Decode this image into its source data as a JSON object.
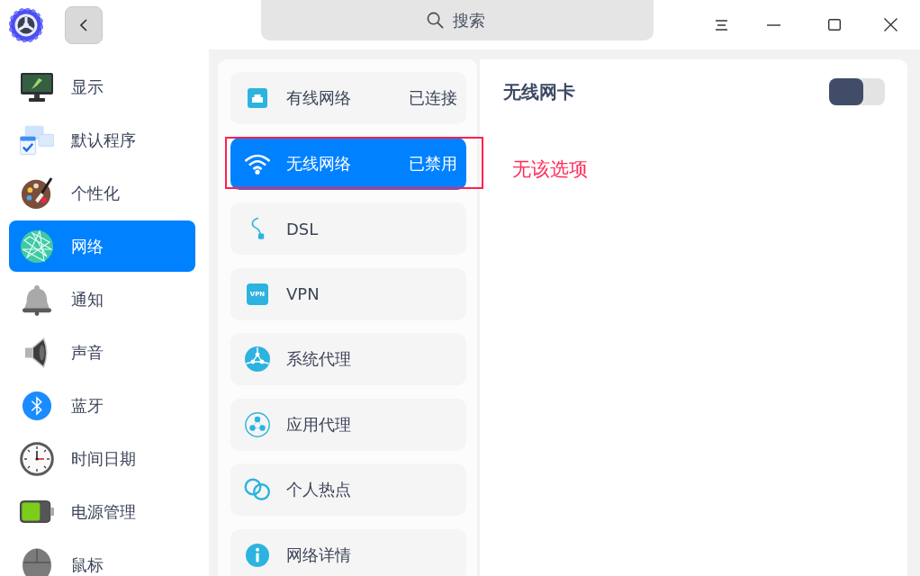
{
  "titlebar": {
    "search": {
      "placeholder": "搜索"
    }
  },
  "sidebar": {
    "items": [
      {
        "label": "显示",
        "selected": false
      },
      {
        "label": "默认程序",
        "selected": false
      },
      {
        "label": "个性化",
        "selected": false
      },
      {
        "label": "网络",
        "selected": true
      },
      {
        "label": "通知",
        "selected": false
      },
      {
        "label": "声音",
        "selected": false
      },
      {
        "label": "蓝牙",
        "selected": false
      },
      {
        "label": "时间日期",
        "selected": false
      },
      {
        "label": "电源管理",
        "selected": false
      },
      {
        "label": "鼠标",
        "selected": false
      }
    ]
  },
  "network_list": {
    "items": [
      {
        "label": "有线网络",
        "status": "已连接",
        "selected": false,
        "highlighted": false
      },
      {
        "label": "无线网络",
        "status": "已禁用",
        "selected": true,
        "highlighted": true
      },
      {
        "label": "DSL",
        "selected": false,
        "highlighted": false
      },
      {
        "label": "VPN",
        "icon_text": "VPN",
        "selected": false,
        "highlighted": false
      },
      {
        "label": "系统代理",
        "selected": false,
        "highlighted": false
      },
      {
        "label": "应用代理",
        "selected": false,
        "highlighted": false
      },
      {
        "label": "个人热点",
        "selected": false,
        "highlighted": false
      },
      {
        "label": "网络详情",
        "selected": false,
        "highlighted": false
      }
    ]
  },
  "detail": {
    "title": "无线网卡",
    "switch": {
      "on": false
    },
    "note": "无该选项"
  }
}
